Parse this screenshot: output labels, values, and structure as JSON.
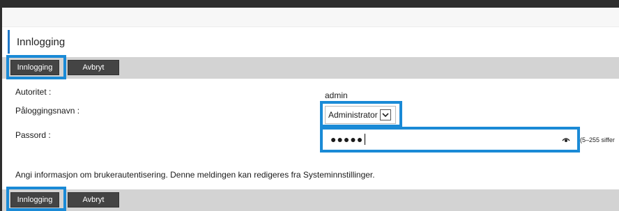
{
  "header": {
    "title": "Innlogging"
  },
  "actions_top": {
    "login_label": "Innlogging",
    "cancel_label": "Avbryt"
  },
  "form": {
    "authority_label": "Autoritet :",
    "authority_value": "admin",
    "username_label": "Påloggingsnavn :",
    "username_value": "Administrator",
    "password_label": "Passord :",
    "password_mask": "●●●●●",
    "password_hint": "(5–255 siffer"
  },
  "info_text": "Angi informasjon om brukerautentisering. Denne meldingen kan redigeres fra Systeminnstillinger.",
  "actions_bottom": {
    "login_label": "Innlogging",
    "cancel_label": "Avbryt"
  },
  "colors": {
    "accent": "#1a8ad6",
    "title_accent": "#1f78c8",
    "button_bg": "#444444",
    "bar_bg": "#d3d3d3"
  },
  "icons": {
    "dropdown": "chevron-down-icon",
    "visibility": "eye-icon"
  }
}
